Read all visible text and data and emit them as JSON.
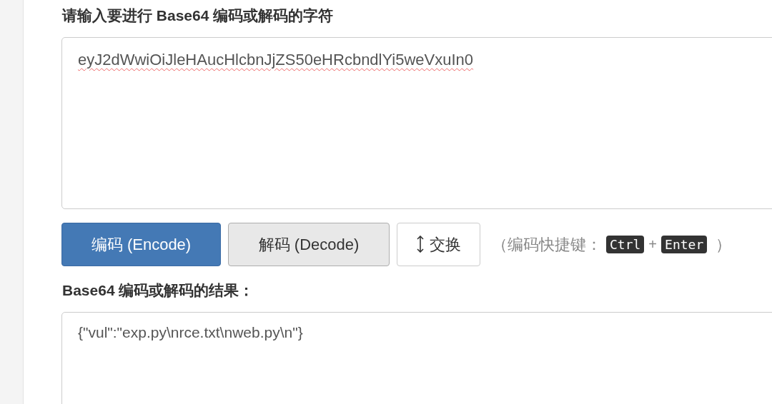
{
  "input_label": "请输入要进行 Base64 编码或解码的字符",
  "input": {
    "value": "eyJ2dWwiOiJleHAucHlcbnJjZS50eHRcbndlYi5weVxuIn0"
  },
  "buttons": [
    {
      "label": "编码 (Encode)",
      "kind": "primary"
    },
    {
      "label": "解码 (Decode)",
      "kind": "secondary"
    },
    {
      "label": "交换",
      "kind": "swap"
    }
  ],
  "shortcut_hint": {
    "prefix": "（编码快捷键：",
    "keys": [
      "Ctrl",
      "Enter"
    ],
    "joiner": "+",
    "suffix": "）"
  },
  "result_label": "Base64 编码或解码的结果：",
  "result": {
    "value": "{\"vul\":\"exp.py\\nrce.txt\\nweb.py\\n\"}"
  }
}
